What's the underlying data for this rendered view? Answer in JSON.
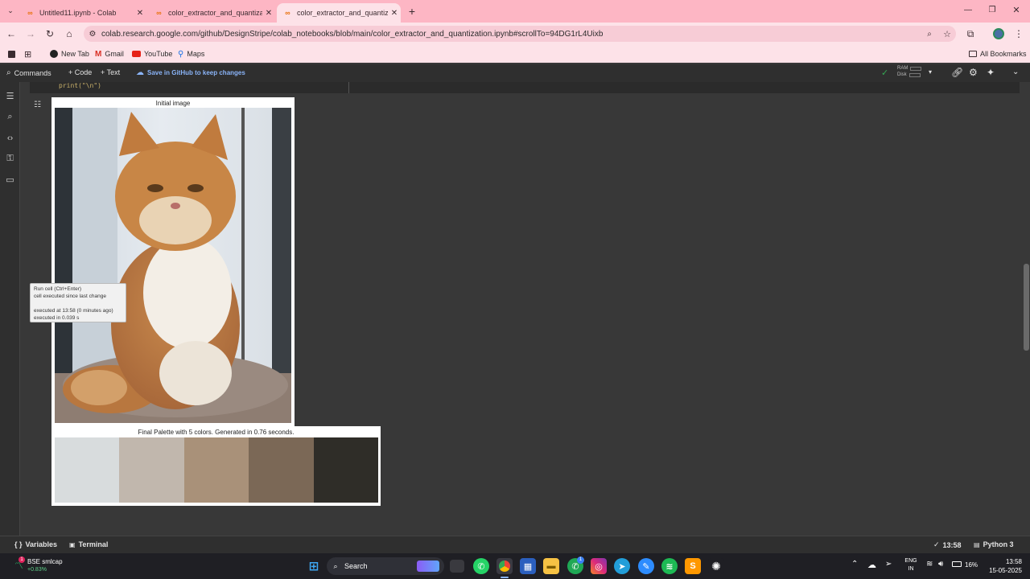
{
  "browser": {
    "tabs": [
      {
        "title": "Untitled11.ipynb - Colab",
        "active": false
      },
      {
        "title": "color_extractor_and_quantizatio",
        "active": false
      },
      {
        "title": "color_extractor_and_quantizatio",
        "active": true
      }
    ],
    "new_tab": "+",
    "url": "colab.research.google.com/github/DesignStripe/colab_notebooks/blob/main/color_extractor_and_quantization.ipynb#scrollTo=94DG1rL4Uixb",
    "bookmarks": [
      "New Tab",
      "Gmail",
      "YouTube",
      "Maps"
    ],
    "all_bookmarks": "All Bookmarks"
  },
  "colab": {
    "commands": "Commands",
    "code": "+ Code",
    "text": "+ Text",
    "save_github": "Save in GitHub to keep changes",
    "ram": "RAM",
    "disk": "Disk",
    "code_line": "print(\"\\n\")",
    "tooltip": {
      "line1": "Run cell (Ctrl+Enter)",
      "line2": "cell executed since last change",
      "line3": "executed at 13:58 (0 minutes ago)",
      "line4": "executed in 0.039 s"
    },
    "initial_image_title": "Initial image",
    "palette_title": "Final Palette with 5 colors. Generated in 0.76 seconds.",
    "palette": [
      "#d8dcdd",
      "#c1b7ad",
      "#a99179",
      "#7b6856",
      "#2f2d28"
    ],
    "variables": "Variables",
    "terminal": "Terminal",
    "status_time": "13:58",
    "runtime": "Python 3"
  },
  "taskbar": {
    "stock_name": "BSE smlcap",
    "stock_change": "+0.83%",
    "stock_badge": "1",
    "search": "Search",
    "lang1": "ENG",
    "lang2": "IN",
    "battery": "16%",
    "time": "13:58",
    "date": "15-05-2025",
    "whatsapp_badge": "1"
  }
}
